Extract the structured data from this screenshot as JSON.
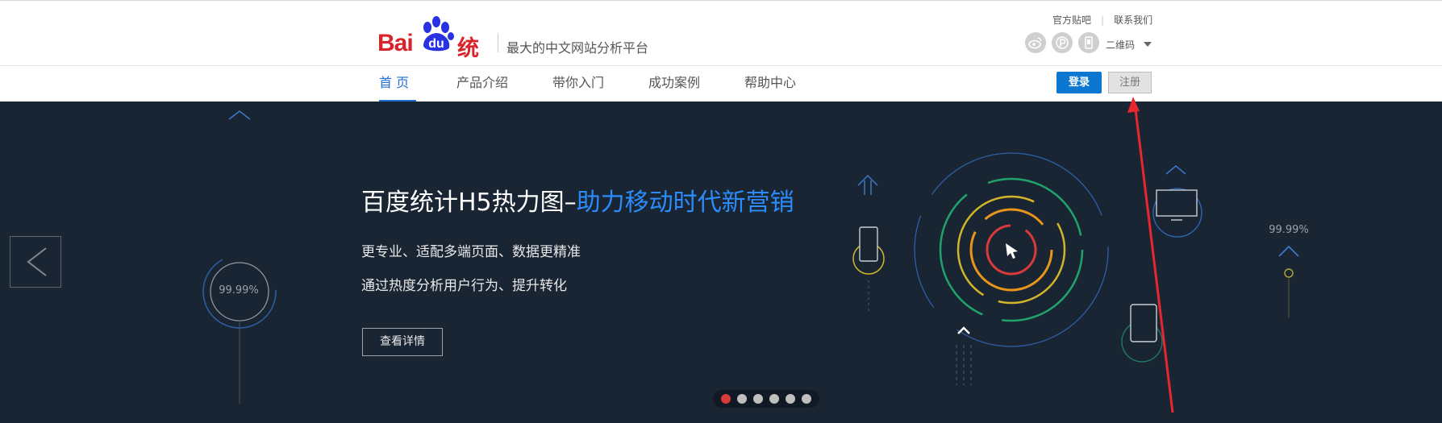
{
  "header": {
    "logo_bai": "Bai",
    "logo_du": "du",
    "logo_tongji": "统计",
    "slogan": "最大的中文网站分析平台",
    "top_links": [
      "官方贴吧",
      "联系我们"
    ],
    "social_icons": [
      "weibo-icon",
      "tieba-icon",
      "mobile-app-icon"
    ],
    "qr_label": "二维码"
  },
  "nav": {
    "items": [
      {
        "label": "首 页",
        "active": true
      },
      {
        "label": "产品介绍",
        "active": false
      },
      {
        "label": "带你入门",
        "active": false
      },
      {
        "label": "成功案例",
        "active": false
      },
      {
        "label": "帮助中心",
        "active": false
      }
    ],
    "login_label": "登录",
    "register_label": "注册"
  },
  "banner": {
    "title_plain": "百度统计H5热力图–",
    "title_highlight": "助力移动时代新营销",
    "line1": "更专业、适配多端页面、数据更精准",
    "line2": "通过热度分析用户行为、提升转化",
    "detail_button": "查看详情",
    "gauge_left": "99.99%",
    "gauge_right": "99.99%",
    "slide_count": 6,
    "active_slide": 1
  },
  "colors": {
    "accent_blue": "#1f6fd3",
    "brand_red": "#d8232a",
    "banner_bg": "#1a2533",
    "annotation_arrow": "#e8262d"
  }
}
